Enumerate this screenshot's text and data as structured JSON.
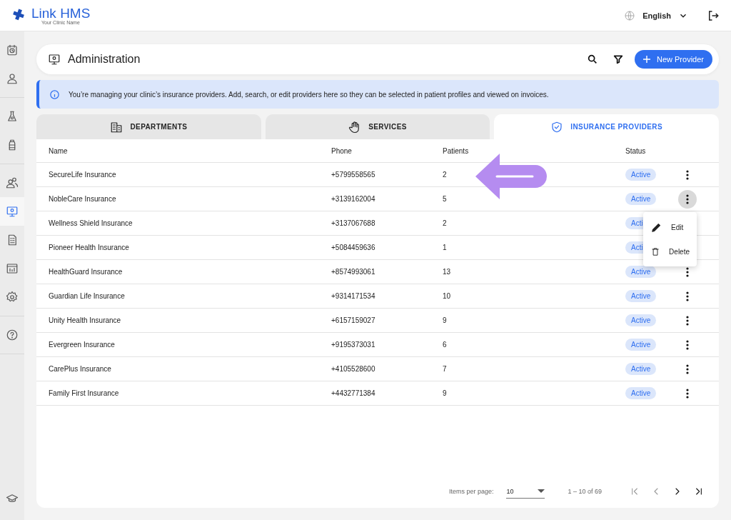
{
  "app": {
    "name_part1": "Link",
    "name_part2": "HMS",
    "subtitle": "Your Clinic Name"
  },
  "top_bar": {
    "language": "English"
  },
  "sidebar": {
    "groups": [
      [
        {
          "selected": false
        },
        {
          "selected": false
        }
      ],
      [
        {
          "selected": false
        },
        {
          "selected": false
        }
      ],
      [
        {
          "selected": false
        },
        {
          "selected": true
        },
        {
          "selected": false
        },
        {
          "selected": false
        },
        {
          "selected": false
        }
      ],
      [
        {
          "selected": false
        }
      ]
    ],
    "bottom": {
      "selected": false
    }
  },
  "header": {
    "title": "Administration",
    "button": "New Provider"
  },
  "info": "You’re managing your clinic’s insurance providers. Add, search, or edit providers here so they can be selected in patient profiles and viewed on invoices.",
  "tabs": [
    {
      "label": "DEPARTMENTS",
      "selected": false
    },
    {
      "label": "SERVICES",
      "selected": false
    },
    {
      "label": "INSURANCE PROVIDERS",
      "selected": true
    }
  ],
  "table": {
    "columns": [
      "Name",
      "Phone",
      "Patients",
      "Status"
    ],
    "rows": [
      {
        "name": "SecureLife Insurance",
        "phone": "+5799558565",
        "patients": "2",
        "status": "Active",
        "menu_open": false
      },
      {
        "name": "NobleCare Insurance",
        "phone": "+3139162004",
        "patients": "5",
        "status": "Active",
        "menu_open": true
      },
      {
        "name": "Wellness Shield Insurance",
        "phone": "+3137067688",
        "patients": "2",
        "status": "Acti"
      },
      {
        "name": "Pioneer Health Insurance",
        "phone": "+5084459636",
        "patients": "1",
        "status": "Acti"
      },
      {
        "name": "HealthGuard Insurance",
        "phone": "+8574993061",
        "patients": "13",
        "status": "Active",
        "menu_open": false
      },
      {
        "name": "Guardian Life Insurance",
        "phone": "+9314171534",
        "patients": "10",
        "status": "Active",
        "menu_open": false
      },
      {
        "name": "Unity Health Insurance",
        "phone": "+6157159027",
        "patients": "9",
        "status": "Active",
        "menu_open": false
      },
      {
        "name": "Evergreen Insurance",
        "phone": "+9195373031",
        "patients": "6",
        "status": "Active",
        "menu_open": false
      },
      {
        "name": "CarePlus Insurance",
        "phone": "+4105528600",
        "patients": "7",
        "status": "Active",
        "menu_open": false
      },
      {
        "name": "Family First Insurance",
        "phone": "+4432771384",
        "patients": "9",
        "status": "Active",
        "menu_open": false
      }
    ]
  },
  "row_menu": [
    "Edit",
    "Delete"
  ],
  "pagination": {
    "label": "Items per page:",
    "page_size": "10",
    "range": "1 – 10 of 69",
    "buttons": [
      {
        "disabled": true
      },
      {
        "disabled": true
      },
      {
        "disabled": false
      },
      {
        "disabled": false
      }
    ]
  }
}
